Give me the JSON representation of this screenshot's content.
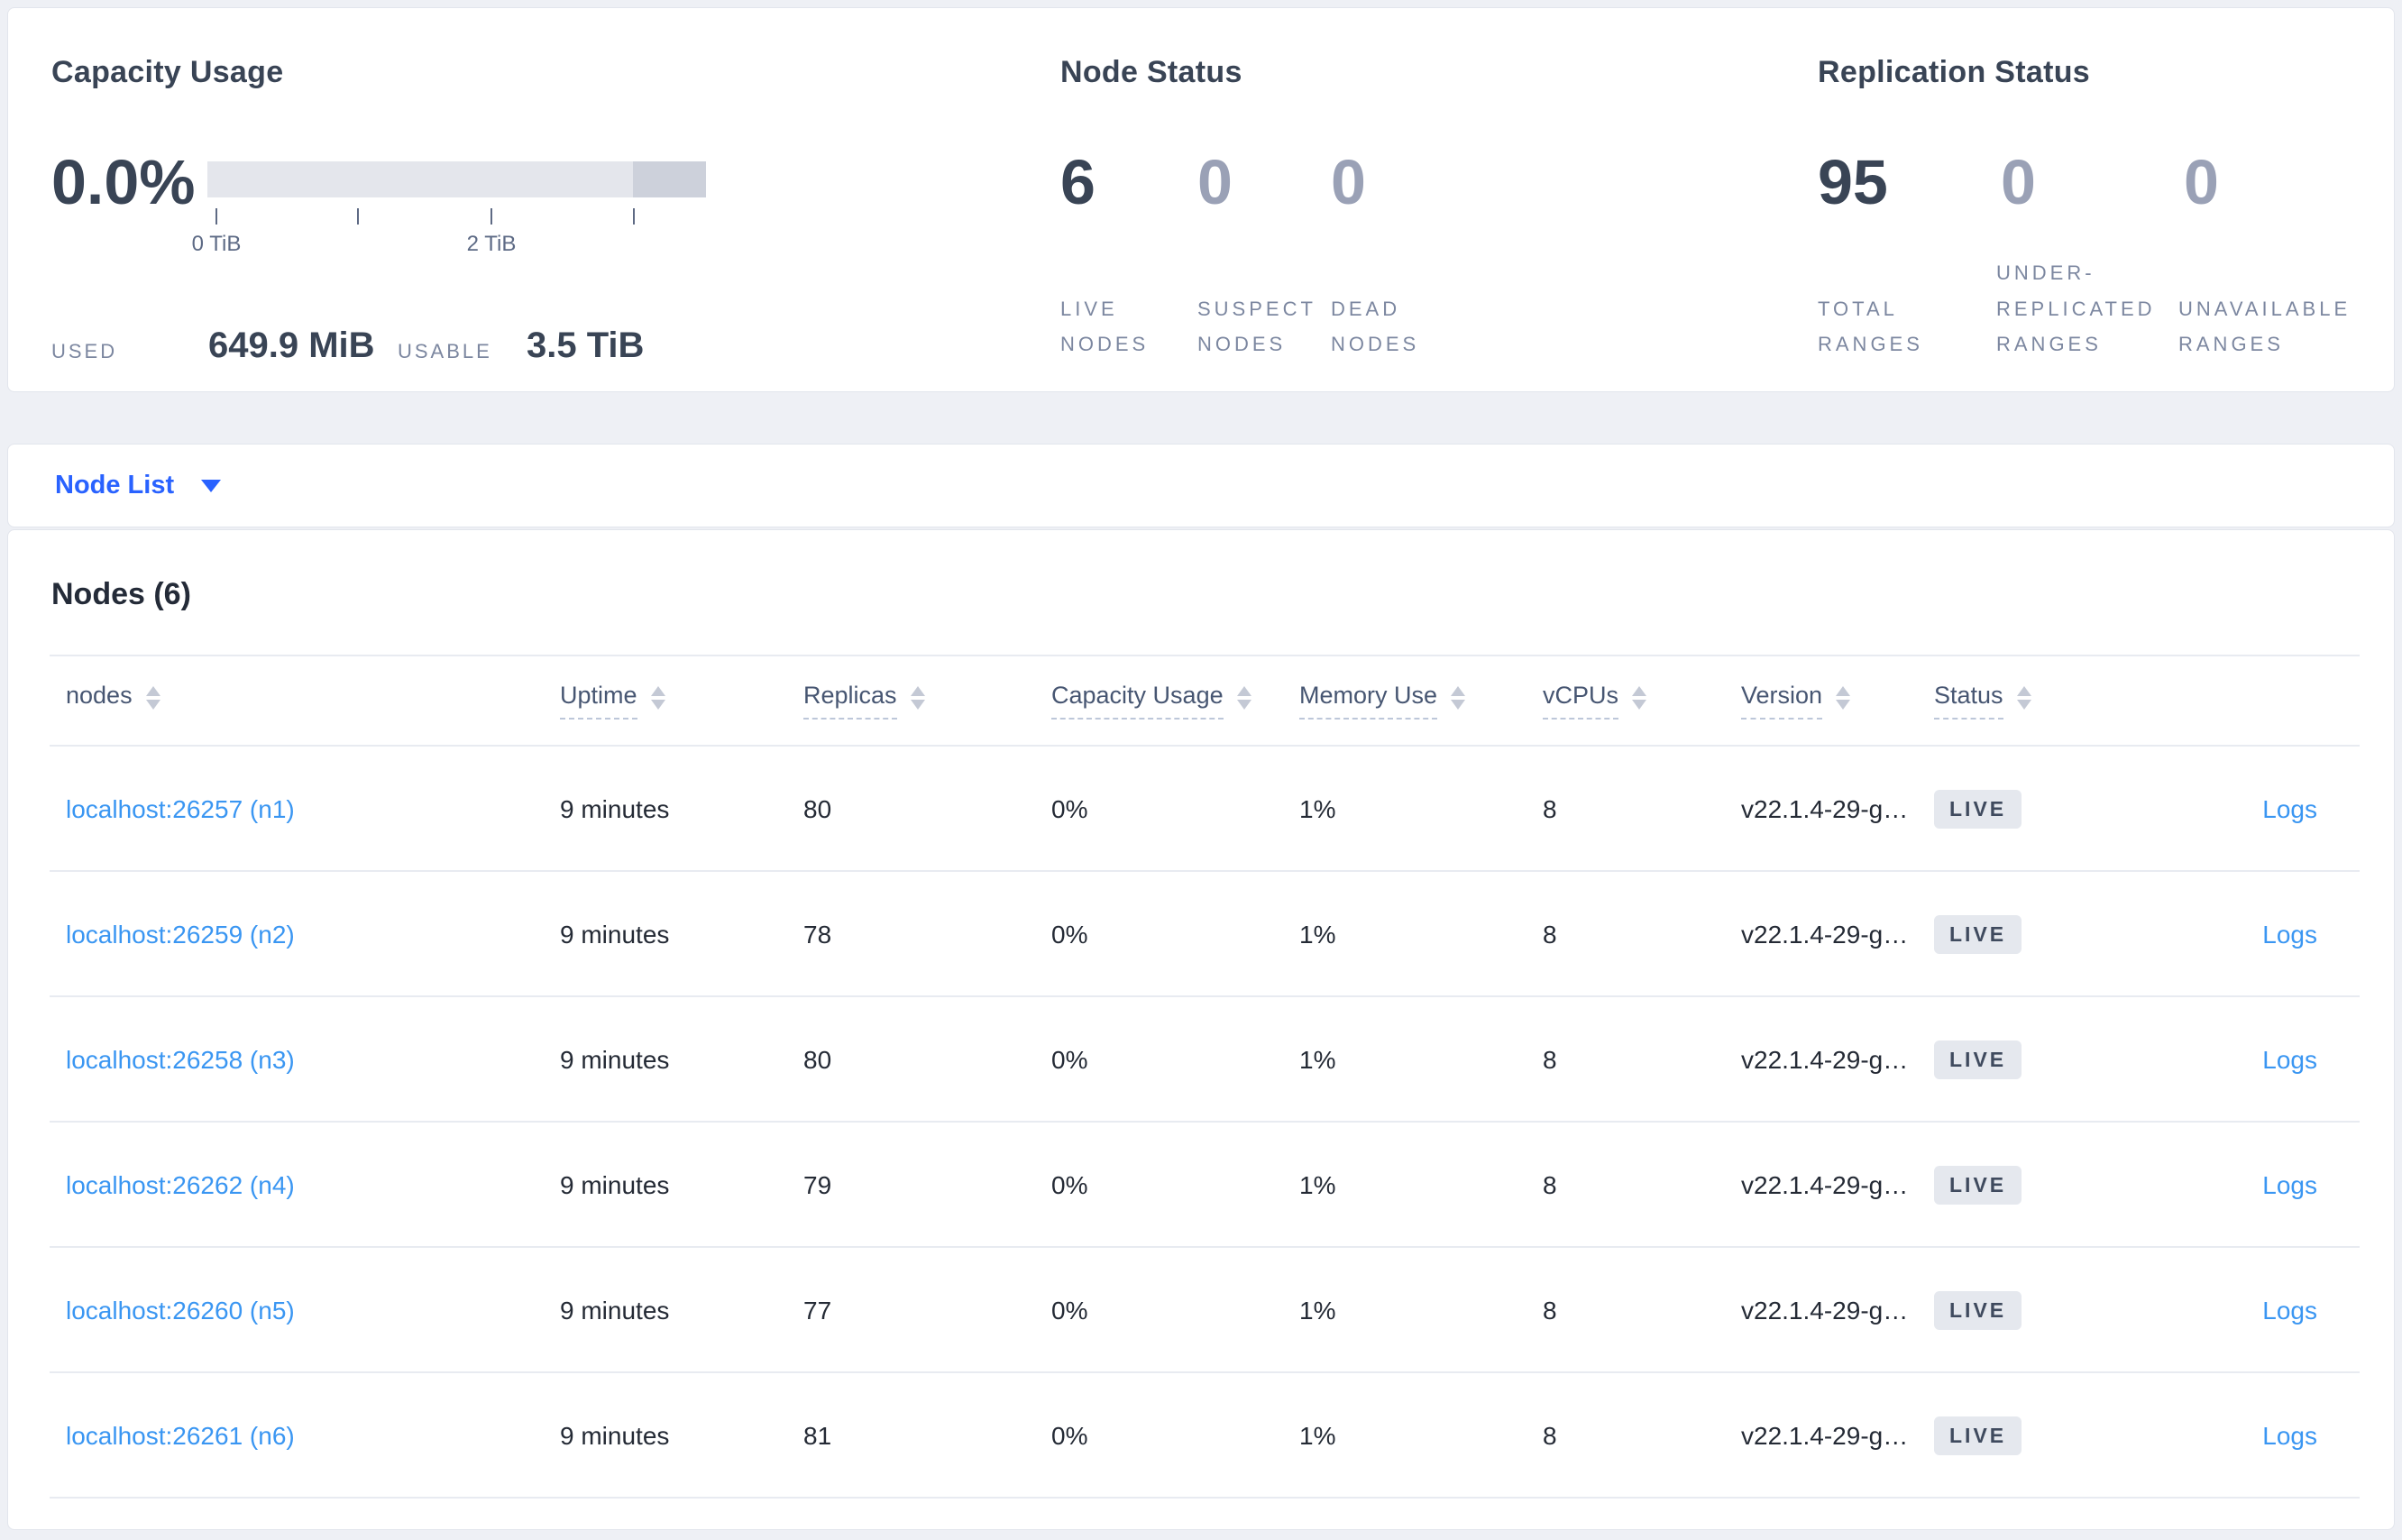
{
  "summary": {
    "capacity": {
      "title": "Capacity Usage",
      "percent": "0.0%",
      "tick_labels": [
        "0 TiB",
        "",
        "2 TiB",
        ""
      ],
      "used_label": "USED",
      "used_value": "649.9 MiB",
      "usable_label": "USABLE",
      "usable_value": "3.5 TiB"
    },
    "node_status": {
      "title": "Node Status",
      "stats": [
        {
          "value": "6",
          "label": "LIVE NODES",
          "emphasis": true
        },
        {
          "value": "0",
          "label": "SUSPECT NODES",
          "emphasis": false
        },
        {
          "value": "0",
          "label": "DEAD NODES",
          "emphasis": false
        }
      ]
    },
    "replication_status": {
      "title": "Replication Status",
      "stats": [
        {
          "value": "95",
          "label": "TOTAL RANGES",
          "emphasis": true
        },
        {
          "value": "0",
          "label": "UNDER-REPLICATED RANGES",
          "emphasis": false
        },
        {
          "value": "0",
          "label": "UNAVAILABLE RANGES",
          "emphasis": false
        }
      ]
    }
  },
  "view_selector": {
    "label": "Node List"
  },
  "table": {
    "title": "Nodes (6)",
    "columns": [
      {
        "key": "node",
        "label": "nodes",
        "sortable": true,
        "underlined": false
      },
      {
        "key": "uptime",
        "label": "Uptime",
        "sortable": true,
        "underlined": true
      },
      {
        "key": "replicas",
        "label": "Replicas",
        "sortable": true,
        "underlined": true
      },
      {
        "key": "capacity",
        "label": "Capacity Usage",
        "sortable": true,
        "underlined": true
      },
      {
        "key": "memory",
        "label": "Memory Use",
        "sortable": true,
        "underlined": true
      },
      {
        "key": "vcpus",
        "label": "vCPUs",
        "sortable": true,
        "underlined": true
      },
      {
        "key": "version",
        "label": "Version",
        "sortable": true,
        "underlined": true
      },
      {
        "key": "status",
        "label": "Status",
        "sortable": true,
        "underlined": true
      },
      {
        "key": "logs",
        "label": "",
        "sortable": false,
        "underlined": false
      }
    ],
    "rows": [
      {
        "node": "localhost:26257 (n1)",
        "uptime": "9 minutes",
        "replicas": "80",
        "capacity": "0%",
        "memory": "1%",
        "vcpus": "8",
        "version": "v22.1.4-29-g…",
        "status": "LIVE",
        "logs": "Logs"
      },
      {
        "node": "localhost:26259 (n2)",
        "uptime": "9 minutes",
        "replicas": "78",
        "capacity": "0%",
        "memory": "1%",
        "vcpus": "8",
        "version": "v22.1.4-29-g…",
        "status": "LIVE",
        "logs": "Logs"
      },
      {
        "node": "localhost:26258 (n3)",
        "uptime": "9 minutes",
        "replicas": "80",
        "capacity": "0%",
        "memory": "1%",
        "vcpus": "8",
        "version": "v22.1.4-29-g…",
        "status": "LIVE",
        "logs": "Logs"
      },
      {
        "node": "localhost:26262 (n4)",
        "uptime": "9 minutes",
        "replicas": "79",
        "capacity": "0%",
        "memory": "1%",
        "vcpus": "8",
        "version": "v22.1.4-29-g…",
        "status": "LIVE",
        "logs": "Logs"
      },
      {
        "node": "localhost:26260 (n5)",
        "uptime": "9 minutes",
        "replicas": "77",
        "capacity": "0%",
        "memory": "1%",
        "vcpus": "8",
        "version": "v22.1.4-29-g…",
        "status": "LIVE",
        "logs": "Logs"
      },
      {
        "node": "localhost:26261 (n6)",
        "uptime": "9 minutes",
        "replicas": "81",
        "capacity": "0%",
        "memory": "1%",
        "vcpus": "8",
        "version": "v22.1.4-29-g…",
        "status": "LIVE",
        "logs": "Logs"
      }
    ]
  },
  "colors": {
    "accent_blue": "#2962ff",
    "link_blue": "#3a96f2",
    "dark_text": "#394455",
    "muted_number": "#9aa1b6",
    "badge_bg": "#e5e8ee",
    "bar_track": "#e4e6ec",
    "bar_dark_segment": "#cdd1db"
  }
}
